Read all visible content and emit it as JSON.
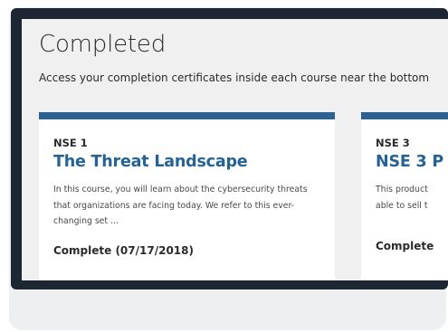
{
  "page": {
    "title": "Completed",
    "subtitle": "Access your completion certificates inside each course near the bottom"
  },
  "courses": [
    {
      "code": "NSE 1",
      "name": "The Threat Landscape",
      "description": "In this course, you will learn about the cybersecurity threats that organizations are facing today.  We refer to this ever-changing set ...",
      "status": "Complete (07/17/2018)"
    },
    {
      "code": "NSE 3",
      "name": "NSE 3 P",
      "description": "This product able to sell t",
      "status": "Complete"
    }
  ],
  "colors": {
    "accent": "#2a6295",
    "frame": "#1c2733",
    "background": "#f0f0f0"
  }
}
